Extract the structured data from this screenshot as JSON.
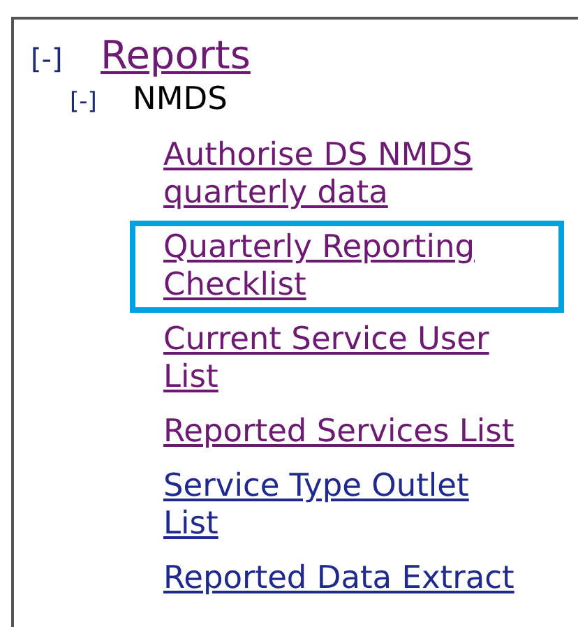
{
  "tree": [
    {
      "label": "Reports",
      "kind": "link",
      "toggle": "[-]",
      "expanded": true,
      "visited": true,
      "children": [
        {
          "label": "NMDS",
          "kind": "folder",
          "toggle": "[-]",
          "expanded": true,
          "children": [
            {
              "label": "Authorise DS NMDS quarterly data",
              "kind": "link",
              "visited": true,
              "highlighted": false
            },
            {
              "label": "Quarterly Reporting Checklist",
              "kind": "link",
              "visited": true,
              "highlighted": true
            },
            {
              "label": "Current Service User List",
              "kind": "link",
              "visited": true,
              "highlighted": false
            },
            {
              "label": "Reported Services List",
              "kind": "link",
              "visited": true,
              "highlighted": false
            },
            {
              "label": "Service Type Outlet List",
              "kind": "link",
              "visited": false,
              "highlighted": false
            },
            {
              "label": "Reported Data Extract",
              "kind": "link",
              "visited": false,
              "highlighted": false
            }
          ]
        }
      ]
    }
  ]
}
